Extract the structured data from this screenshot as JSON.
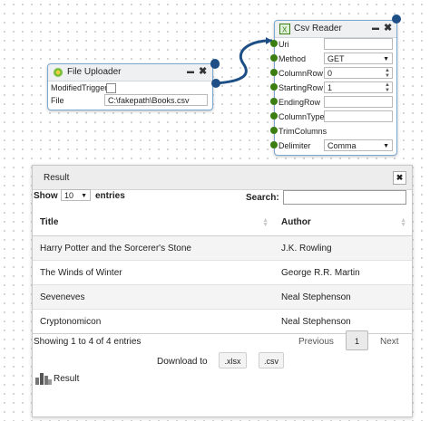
{
  "colors": {
    "node_border": "#7aa9d6",
    "port_green": "#3b7d12",
    "wire_blue": "#1d4f86",
    "canvas": "#ffffff"
  },
  "file_uploader": {
    "title": "File Uploader",
    "icon": "file-uploader-icon",
    "minimize": "▬",
    "close": "✖",
    "fields": {
      "modified_trigger_label": "ModifiedTrigger",
      "file_label": "File",
      "file_value": "C:\\fakepath\\Books.csv"
    }
  },
  "csv_reader": {
    "title": "Csv Reader",
    "icon": "excel-icon",
    "minimize": "▬",
    "close": "✖",
    "fields": {
      "uri_label": "Uri",
      "uri_value": "",
      "method_label": "Method",
      "method_value": "GET",
      "column_row_label": "ColumnRow",
      "column_row_value": "0",
      "starting_row_label": "StartingRow",
      "starting_row_value": "1",
      "ending_row_label": "EndingRow",
      "ending_row_value": "",
      "column_types_label": "ColumnTypes",
      "column_types_value": "",
      "trim_columns_label": "TrimColumns",
      "delimiter_label": "Delimiter",
      "delimiter_value": "Comma"
    }
  },
  "result_panel": {
    "title": "Result",
    "close": "✖",
    "show_label": "Show",
    "entries_value": "10",
    "entries_label": "entries",
    "search_label": "Search:",
    "columns": [
      "Title",
      "Author"
    ],
    "rows": [
      {
        "title": "Harry Potter and the Sorcerer's Stone",
        "author": "J.K. Rowling"
      },
      {
        "title": "The Winds of Winter",
        "author": "George R.R. Martin"
      },
      {
        "title": "Seveneves",
        "author": "Neal Stephenson"
      },
      {
        "title": "Cryptonomicon",
        "author": "Neal Stephenson"
      }
    ],
    "info": "Showing 1 to 4 of 4 entries",
    "previous": "Previous",
    "page": "1",
    "next": "Next",
    "download_label": "Download to",
    "xlsx": ".xlsx",
    "csv": ".csv",
    "footer_label": "Result",
    "footer_icon": "chart-icon"
  }
}
